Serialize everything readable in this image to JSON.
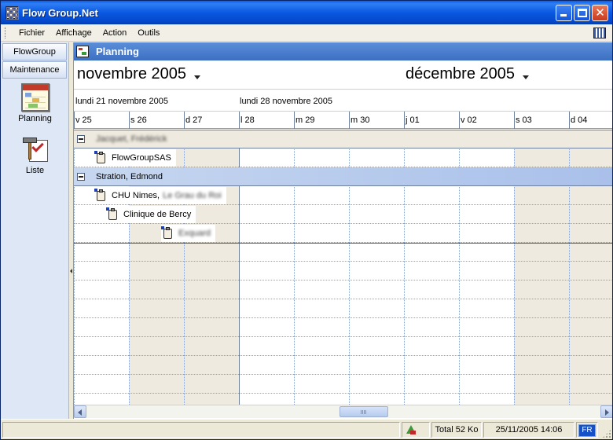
{
  "window": {
    "title": "Flow Group.Net",
    "accent_color": "#0a5ee8"
  },
  "menu": {
    "items": [
      "Fichier",
      "Affichage",
      "Action",
      "Outils"
    ]
  },
  "sidebar": {
    "tabs": [
      "FlowGroup",
      "Maintenance"
    ],
    "items": [
      {
        "label": "Planning",
        "icon": "planning-icon"
      },
      {
        "label": "Liste",
        "icon": "checklist-icon"
      }
    ]
  },
  "pane": {
    "title": "Planning"
  },
  "calendar": {
    "months": [
      "novembre 2005",
      "décembre 2005"
    ],
    "weeks": [
      "lundi 21 novembre 2005",
      "lundi 28 novembre 2005"
    ],
    "days": [
      "v 25",
      "s 26",
      "d 27",
      "l 28",
      "m 29",
      "m 30",
      "j 01",
      "v 02",
      "s 03",
      "d 04"
    ]
  },
  "groups": [
    {
      "name": "Jacquet, Frédérick",
      "blurred": true
    },
    {
      "name": "Stration, Edmond",
      "blurred": false
    }
  ],
  "entries": [
    {
      "label": "FlowGroupSAS",
      "suffix": ""
    },
    {
      "label": "CHU Nimes,",
      "suffix": "Le Grau du Roi"
    },
    {
      "label": "Clinique de Bercy",
      "suffix": ""
    },
    {
      "label": "",
      "suffix": "Exquard"
    }
  ],
  "status": {
    "total": "Total 52 Ko",
    "datetime": "25/11/2005 14:06",
    "language": "FR"
  }
}
